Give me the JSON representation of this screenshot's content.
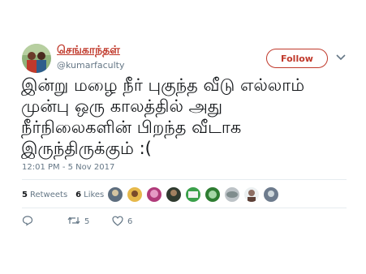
{
  "tweet": {
    "display_name": "செங்காந்தள்",
    "handle": "@kumarfaculty",
    "follow_label": "Follow",
    "text": "இன்று மழை நீர் புகுந்த வீடு எல்லாம்\nமுன்பு ஒரு காலத்தில் அது\nநீர்நிலைகளின் பிறந்த வீடாக\nஇருந்திருக்கும் :(",
    "timestamp": "12:01 PM - 5 Nov 2017"
  },
  "stats": {
    "retweets_count": "5",
    "retweets_label": "Retweets",
    "likes_count": "6",
    "likes_label": "Likes"
  },
  "actions": {
    "reply_icon": "reply-icon",
    "retweet_count": "5",
    "like_count": "6"
  },
  "colors": {
    "accent": "#c0392b",
    "muted": "#657786",
    "divider": "#e6ecf0"
  }
}
